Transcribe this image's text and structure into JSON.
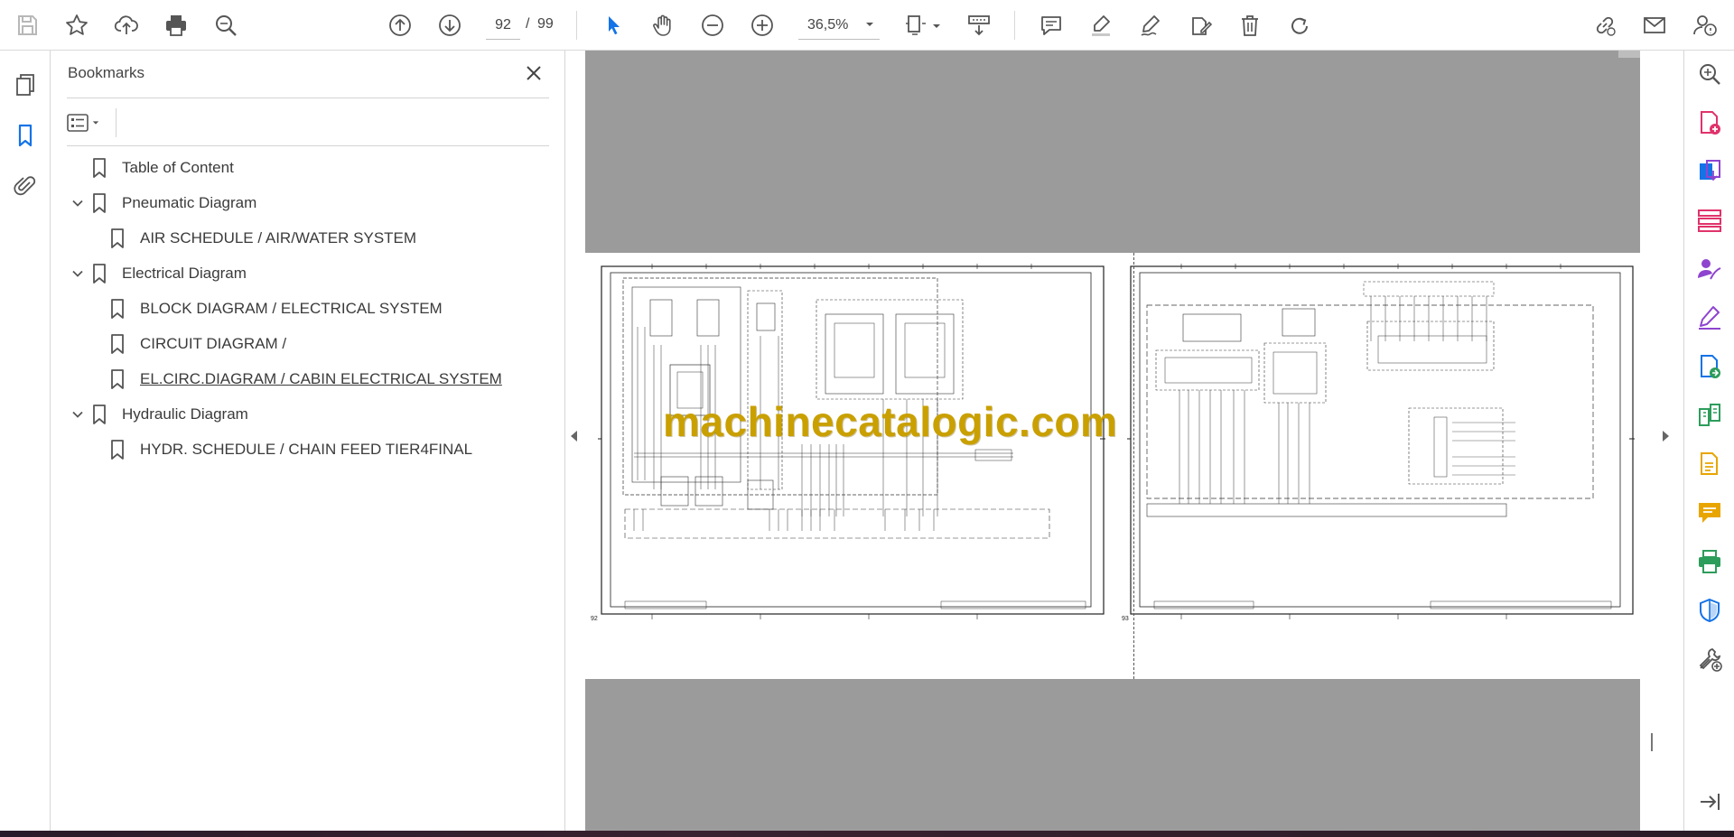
{
  "toolbar": {
    "current_page": "92",
    "page_separator": "/",
    "total_pages": "99",
    "zoom": "36,5%"
  },
  "bookmarks": {
    "title": "Bookmarks",
    "items": [
      {
        "label": "Table of Content",
        "level": 0,
        "expandable": false
      },
      {
        "label": "Pneumatic Diagram",
        "level": 0,
        "expandable": true,
        "expanded": true
      },
      {
        "label": "AIR SCHEDULE / AIR/WATER SYSTEM",
        "level": 1,
        "expandable": false
      },
      {
        "label": "Electrical Diagram",
        "level": 0,
        "expandable": true,
        "expanded": true
      },
      {
        "label": "BLOCK DIAGRAM / ELECTRICAL SYSTEM",
        "level": 1,
        "expandable": false
      },
      {
        "label": "CIRCUIT DIAGRAM /",
        "level": 1,
        "expandable": false
      },
      {
        "label": "EL.CIRC.DIAGRAM / CABIN ELECTRICAL SYSTEM",
        "level": 1,
        "expandable": false,
        "hovered": true
      },
      {
        "label": "Hydraulic Diagram",
        "level": 0,
        "expandable": true,
        "expanded": true
      },
      {
        "label": "HYDR. SCHEDULE / CHAIN FEED TIER4FINAL",
        "level": 1,
        "expandable": false
      }
    ]
  },
  "document": {
    "watermark": "machinecatalogic.com",
    "left_page_number": "92",
    "right_page_number": "93",
    "background_color": "#9b9b9b",
    "watermark_color": "#c9a000"
  },
  "colors": {
    "accent_blue": "#1473e6",
    "tool_pink": "#e0336b",
    "tool_purple": "#8e44cf",
    "tool_green": "#2d9d5c",
    "tool_yellow": "#e8a500"
  },
  "icons": {
    "toolbar": [
      "save-icon",
      "star-icon",
      "upload-icon",
      "print-icon",
      "zoom-search-icon",
      "page-up-icon",
      "page-down-icon",
      "select-cursor-icon",
      "hand-icon",
      "zoom-out-icon",
      "zoom-in-icon",
      "page-fit-icon",
      "scroll-mode-icon",
      "comment-icon",
      "highlight-icon",
      "draw-icon",
      "fill-sign-icon",
      "delete-icon",
      "rotate-icon",
      "link-icon",
      "mail-icon",
      "user-help-icon"
    ],
    "left_rail": [
      "page-thumbnails-icon",
      "bookmark-icon",
      "attachment-icon"
    ],
    "right_rail": [
      "zoom-search-icon",
      "create-pdf-icon",
      "export-pdf-icon",
      "organize-pages-icon",
      "request-signature-icon",
      "fill-sign-icon",
      "edit-pdf-icon",
      "compare-icon",
      "scan-ocr-icon",
      "comment-icon",
      "print-production-icon",
      "protect-icon",
      "more-tools-icon",
      "expand-panel-icon"
    ]
  }
}
